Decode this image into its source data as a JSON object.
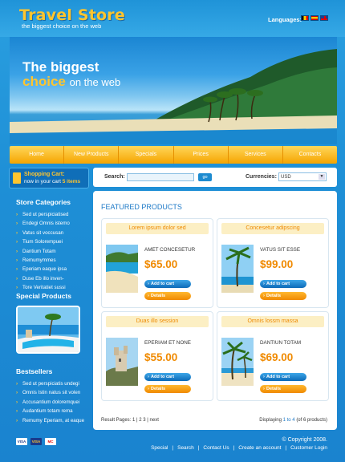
{
  "header": {
    "logo_title": "Travel Store",
    "logo_subtitle": "the biggest choice on the web",
    "languages_label": "Languages:"
  },
  "banner": {
    "line1": "The biggest",
    "line2_highlight": "choice",
    "line2_rest": "on the web"
  },
  "nav": [
    "Home",
    "New Products",
    "Specials",
    "Prices",
    "Services",
    "Contacts"
  ],
  "cart": {
    "title": "Shopping Cart:",
    "line_prefix": "now in your cart",
    "count": "5",
    "line_suffix": "items"
  },
  "sidebar": {
    "categories_title": "Store Categories",
    "categories": [
      "Sed ut perspiciatised",
      "Endegi Omnis istemo",
      "Vatus sit voccusan",
      "Tium Solorempuei",
      "Dantium Totam",
      "Remumymmes",
      "Eperiam eaque ipsa",
      "Duse Eb illo inven-",
      "Tore Veritatiet sussi"
    ],
    "specials_title": "Special Products",
    "bestsellers_title": "Bestsellers",
    "bestsellers": [
      "Sed ut perspiciatis undegi",
      "Omnis Istin natus sit volen",
      "Accusantium doloremquei",
      "Audantium totam rema",
      "Remumy Eperiam, at eaque"
    ],
    "payment_cards": [
      "VISA",
      "VISA",
      "MC"
    ]
  },
  "search": {
    "label": "Search:",
    "value": "",
    "go_label": "go",
    "currency_label": "Currencies:",
    "currency_value": "USD"
  },
  "main": {
    "title": "FEATURED PRODUCTS",
    "products": [
      {
        "heading": "Lorem ipsum dolor sed",
        "name": "AMET CONCESETUR",
        "price": "$65.00",
        "cart_label": "Add to cart",
        "details_label": "Details"
      },
      {
        "heading": "Concesetur adipscing",
        "name": "VATUS SIT ESSE",
        "price": "$99.00",
        "cart_label": "Add to cart",
        "details_label": "Details"
      },
      {
        "heading": "Duas illo session",
        "name": "EPERIAM ET NONE",
        "price": "$55.00",
        "cart_label": "Add to cart",
        "details_label": "Details"
      },
      {
        "heading": "Omnis lossm massa",
        "name": "DANTIUN TOTAM",
        "price": "$69.00",
        "cart_label": "Add to cart",
        "details_label": "Details"
      }
    ],
    "pager_label": "Result Pages:",
    "pages": [
      "1",
      "2",
      "3"
    ],
    "next_label": "next",
    "display_prefix": "Displaying",
    "display_range": "1 to 4",
    "display_suffix": "(of 6 products)"
  },
  "footer": {
    "copyright": "©  Copyright 2008.",
    "links": [
      "Special",
      "Search",
      "Contact Us",
      "Create an account",
      "Customer Login"
    ]
  },
  "colors": {
    "accent_orange": "#f08a00",
    "brand_yellow": "#ffc52e",
    "brand_blue": "#1d8bd0"
  }
}
